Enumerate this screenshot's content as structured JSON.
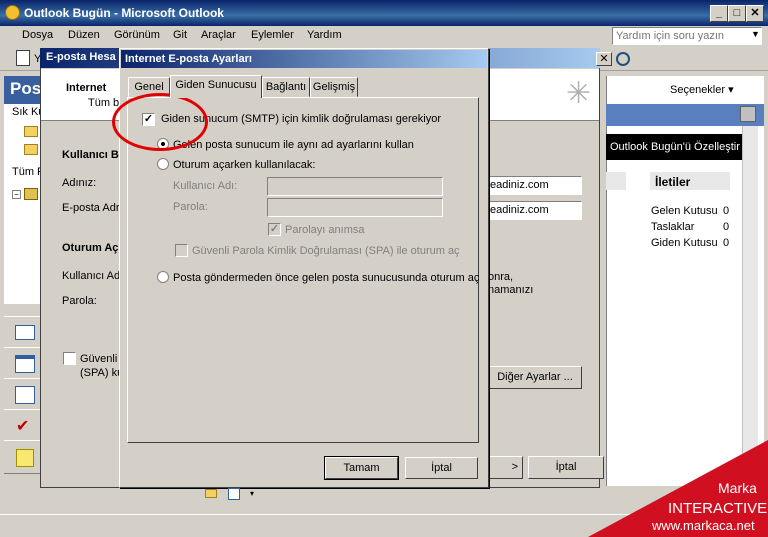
{
  "window": {
    "title": "Outlook Bugün - Microsoft Outlook",
    "min": "_",
    "max": "□",
    "close": "✕"
  },
  "menu": [
    "Dosya",
    "Düzen",
    "Görünüm",
    "Git",
    "Araçlar",
    "Eylemler",
    "Yardım"
  ],
  "help": {
    "placeholder": "Yardım için soru yazın"
  },
  "toolbar": {
    "y_label": "Y",
    "back_dialog_title": "E-posta Hesa"
  },
  "nav": {
    "header": "Pos",
    "section1": "Sık Ku",
    "section2": "Tüm F"
  },
  "bgdialog": {
    "internet_title": "Internet",
    "internet_sub": "Tüm bu",
    "user_info": "Kullanıcı Bi",
    "name_label": "Adınız:",
    "email_label": "E-posta Adr",
    "logon_info": "Oturum Aç",
    "username_label": "Kullanıcı Adı:",
    "password_label": "Parola:",
    "spa_label1": "Güvenli l",
    "spa_label2": "(SPA) ku",
    "field1": "eadiniz.com",
    "field2": "eadiniz.com",
    "note1": "onra,",
    "note2": "namanızı",
    "more_settings": "Diğer Ayarlar ...",
    "back_btn": ">",
    "cancel_btn": "İptal"
  },
  "rightpanel": {
    "options": "Seçenekler ▾",
    "customize": "Outlook Bugün'ü Özelleştir ...",
    "messages_title": "İletiler",
    "items": [
      {
        "name": "Gelen Kutusu",
        "count": "0"
      },
      {
        "name": "Taslaklar",
        "count": "0"
      },
      {
        "name": "Giden Kutusu",
        "count": "0"
      }
    ]
  },
  "dialog": {
    "title": "Internet E-posta Ayarları",
    "close": "✕",
    "tabs": [
      "Genel",
      "Giden Sunucusu",
      "Bağlantı",
      "Gelişmiş"
    ],
    "smtp_auth": "Giden sunucum (SMTP) için kimlik doğrulaması gerekiyor",
    "same_settings": "Gelen posta sunucum ile aynı ad ayarlarını kullan",
    "logon_using": "Oturum açarken kullanılacak:",
    "username_label": "Kullanıcı Adı:",
    "password_label": "Parola:",
    "remember_password": "Parolayı anımsa",
    "spa": "Güvenli Parola Kimlik Doğrulaması (SPA) ile oturum aç",
    "log_on_before": "Posta göndermeden önce gelen posta sunucusunda oturum aç",
    "ok": "Tamam",
    "cancel": "İptal"
  },
  "watermark": {
    "brand": "Marka",
    "line2": "INTERACTIVE",
    "url": "www.markaca.net"
  }
}
